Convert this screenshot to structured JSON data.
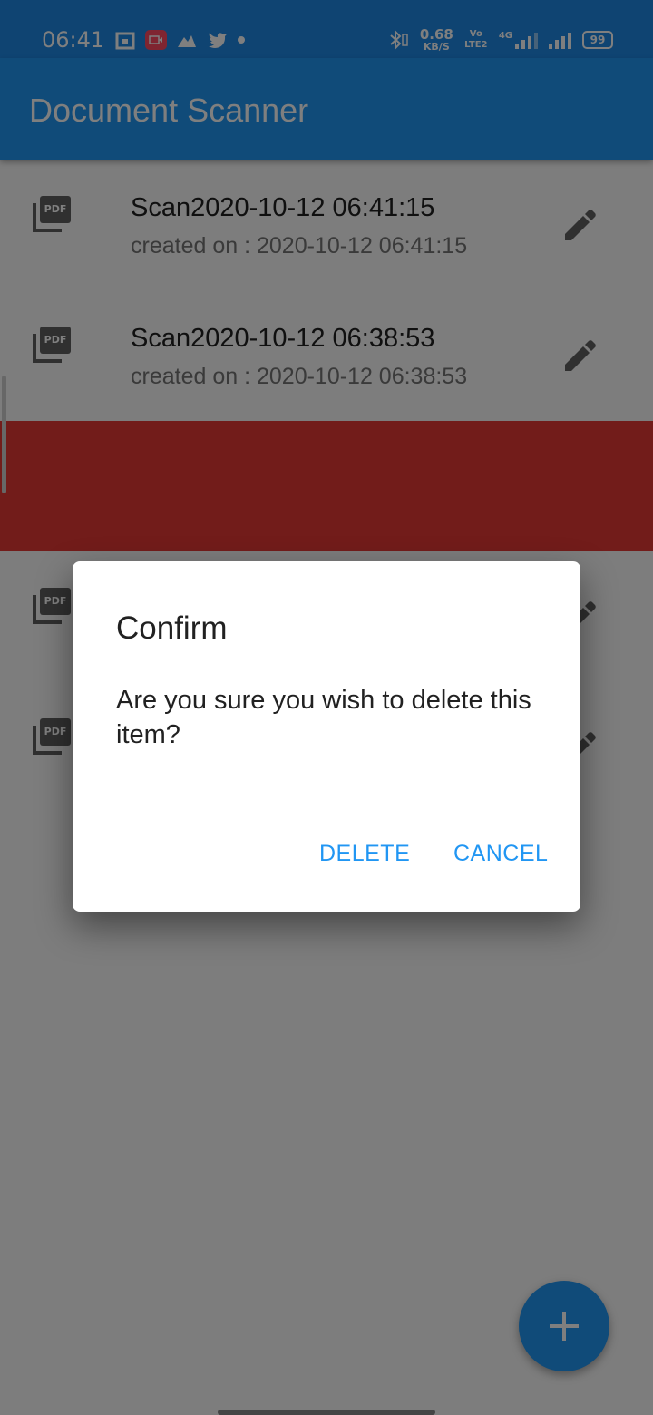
{
  "status_bar": {
    "time": "06:41",
    "network_speed": "0.68",
    "network_unit": "KB/S",
    "volte_label": "Vo LTE2",
    "network_type": "4G",
    "battery": "99"
  },
  "app_bar": {
    "title": "Document Scanner"
  },
  "documents": [
    {
      "name": "Scan2020-10-12 06:41:15",
      "created": "created on : 2020-10-12 06:41:15",
      "icon": "pdf-icon"
    },
    {
      "name": "Scan2020-10-12 06:38:53",
      "created": "created on : 2020-10-12 06:38:53",
      "icon": "pdf-icon"
    }
  ],
  "pdf_badge": "PDF",
  "dialog": {
    "title": "Confirm",
    "message": "Are you sure you wish to delete this item?",
    "delete_label": "DELETE",
    "cancel_label": "CANCEL"
  },
  "colors": {
    "primary": "#2196f3",
    "swipe_delete": "#e53935",
    "scrim": "rgba(0,0,0,0.5)"
  }
}
